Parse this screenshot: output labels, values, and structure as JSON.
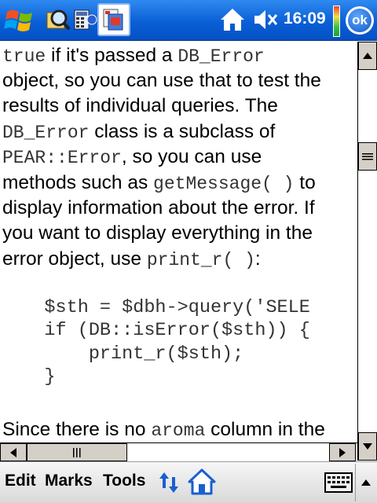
{
  "taskbar": {
    "clock": "16:09",
    "ok_label": "ok"
  },
  "content": {
    "lines": [
      [
        {
          "t": "true",
          "code": true
        },
        {
          "t": " if it's passed a "
        },
        {
          "t": "DB_Error",
          "code": true
        }
      ],
      [
        {
          "t": "object, so you can use that to test the"
        }
      ],
      [
        {
          "t": "results of individual queries. The"
        }
      ],
      [
        {
          "t": "DB_Error",
          "code": true
        },
        {
          "t": " class is a subclass of"
        }
      ],
      [
        {
          "t": "PEAR::Error",
          "code": true
        },
        {
          "t": ", so you can use"
        }
      ],
      [
        {
          "t": "methods such as "
        },
        {
          "t": "getMessage( )",
          "code": true
        },
        {
          "t": " to"
        }
      ],
      [
        {
          "t": "display information about the error. If"
        }
      ],
      [
        {
          "t": "you want to display everything in the"
        }
      ],
      [
        {
          "t": "error object, use "
        },
        {
          "t": "print_r( )",
          "code": true
        },
        {
          "t": ":"
        }
      ]
    ],
    "code_lines": [
      "    $sth = $dbh->query('SELE",
      "    if (DB::isError($sth)) {",
      "        print_r($sth);",
      "    }"
    ],
    "tail_line": [
      {
        "t": "Since there is no "
      },
      {
        "t": "aroma",
        "code": true
      },
      {
        "t": " column in the"
      }
    ]
  },
  "menubar": {
    "edit": "Edit",
    "marks": "Marks",
    "tools": "Tools"
  },
  "icons": {
    "start": "windows-flag-icon",
    "search": "magnifier-search-icon",
    "calc": "calculator-icon",
    "active_app": "reader-app-icon",
    "home": "home-icon",
    "volume": "speaker-muted-icon",
    "sync": "sync-arrows-icon",
    "home_nav": "home-nav-icon",
    "keyboard": "keyboard-icon"
  },
  "colors": {
    "taskbar": "#0a5fd6",
    "text": "#000000",
    "code": "#333333",
    "scroll": "#d4d0c8"
  }
}
